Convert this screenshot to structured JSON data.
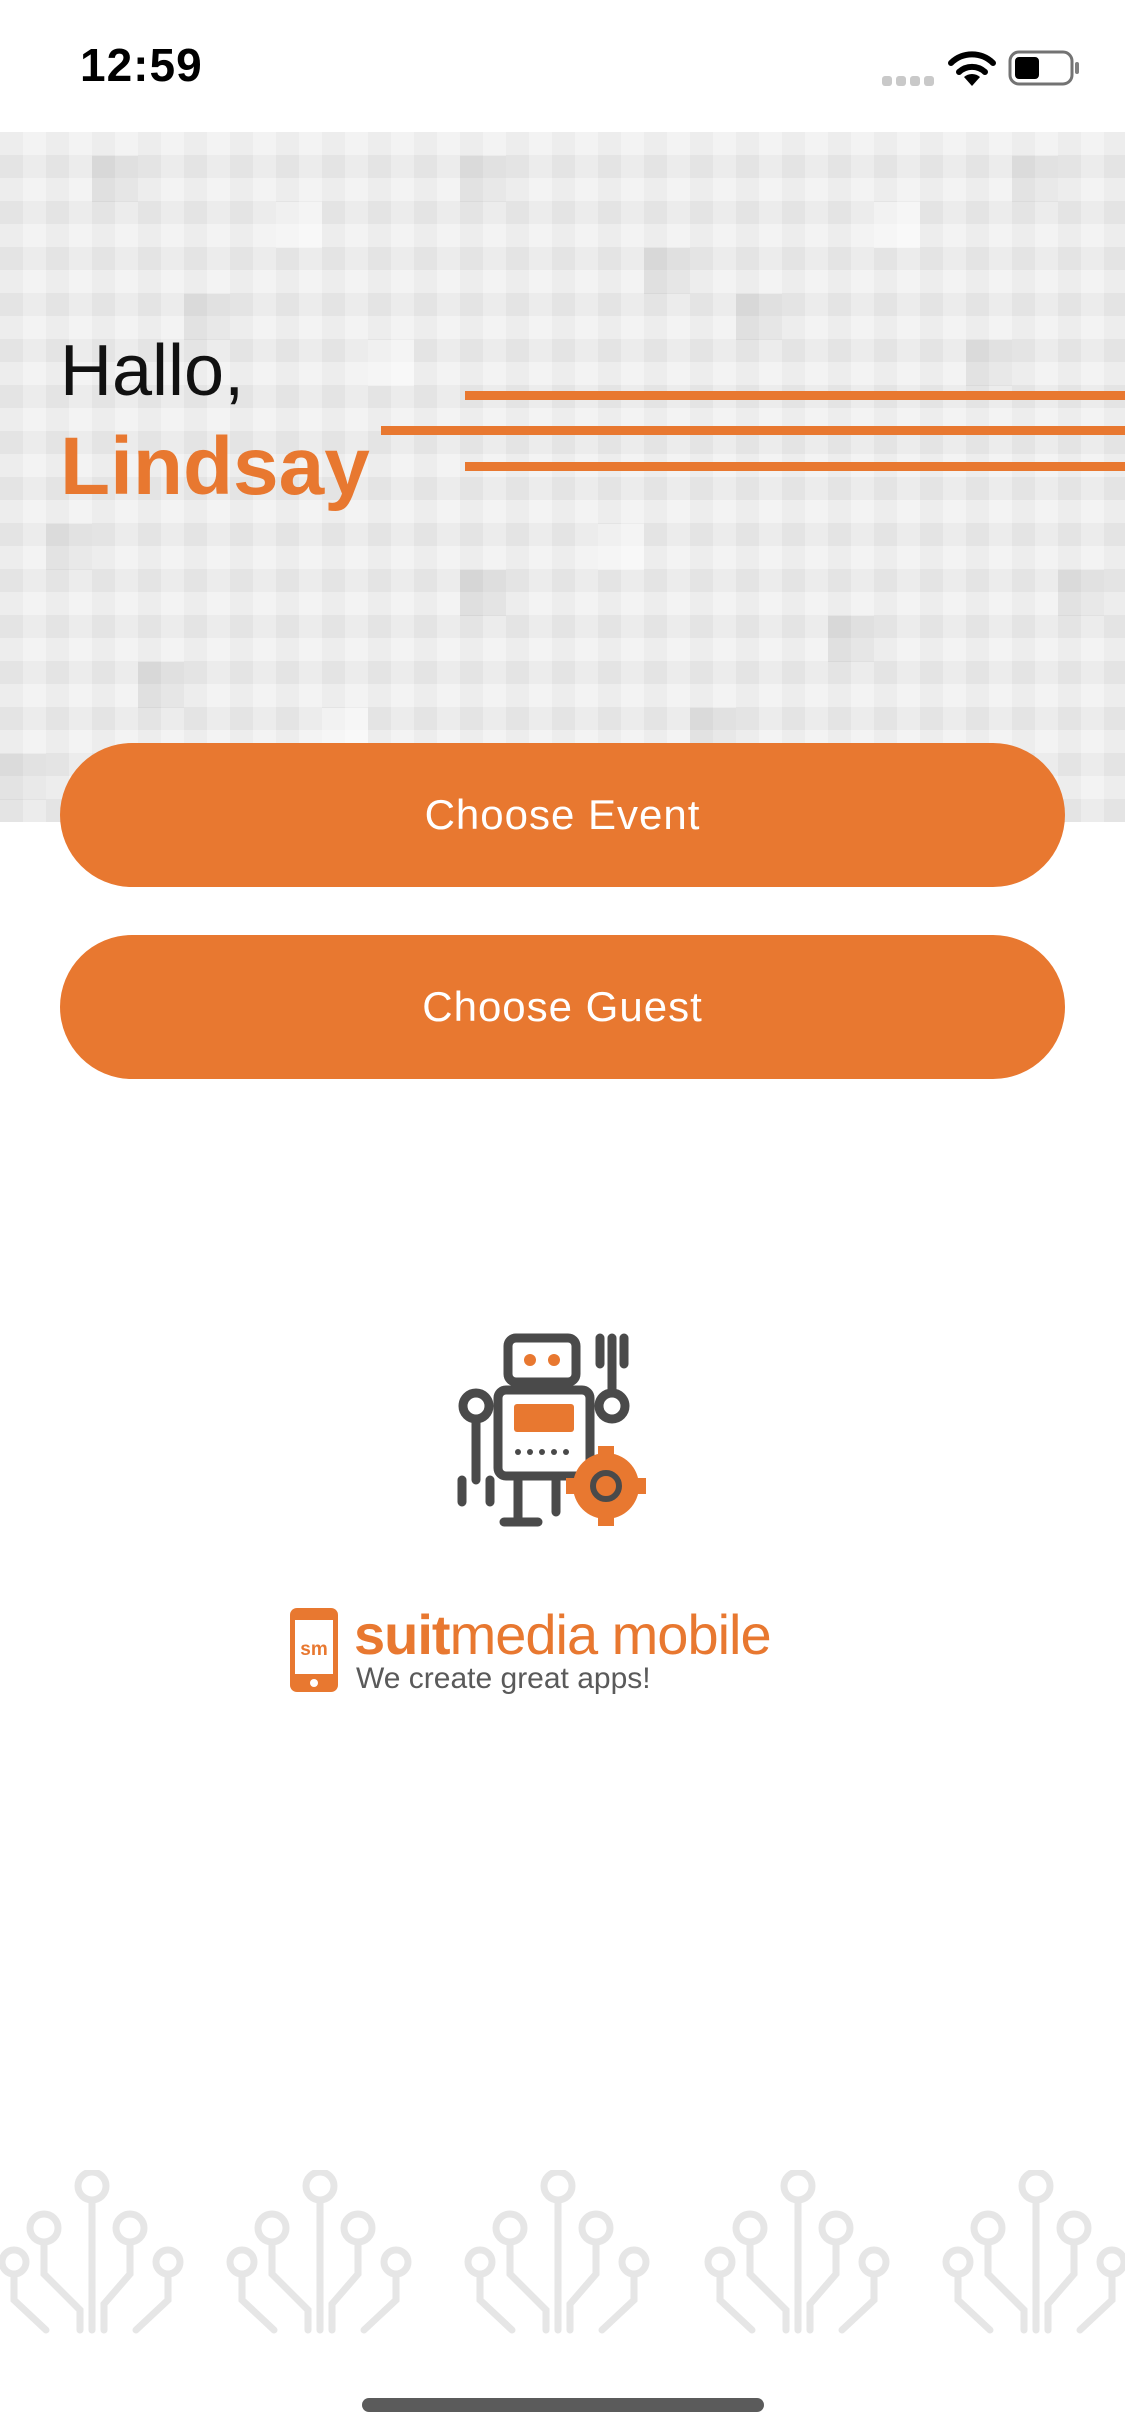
{
  "status_bar": {
    "time": "12:59"
  },
  "header": {
    "greeting": "Hallo,",
    "user_name": "Lindsay"
  },
  "actions": {
    "choose_event": "Choose Event",
    "choose_guest": "Choose Guest"
  },
  "branding": {
    "brand_bold": "suit",
    "brand_rest": "media mobile",
    "phone_badge": "sm",
    "tagline": "We create great apps!"
  },
  "theme": {
    "accent": "#E87830",
    "text": "#111111"
  },
  "icons": [
    "signal-icon",
    "wifi-icon",
    "battery-icon",
    "robot-icon",
    "gear-icon",
    "phone-icon",
    "circuit-decoration"
  ]
}
